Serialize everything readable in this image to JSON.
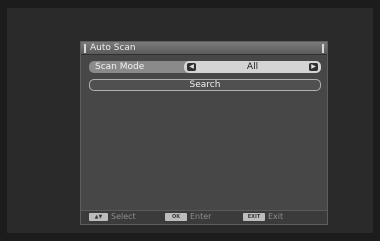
{
  "window": {
    "title": "Auto Scan"
  },
  "scan_mode": {
    "label": "Scan Mode",
    "value": "All",
    "left_arrow_icon": "arrow-left-icon",
    "right_arrow_icon": "arrow-right-icon"
  },
  "search_button": {
    "label": "Search"
  },
  "footer": {
    "select": {
      "key": "▲▼",
      "label": "Select"
    },
    "enter": {
      "key": "OK",
      "label": "Enter"
    },
    "exit": {
      "key": "EXIT",
      "label": "Exit"
    }
  }
}
